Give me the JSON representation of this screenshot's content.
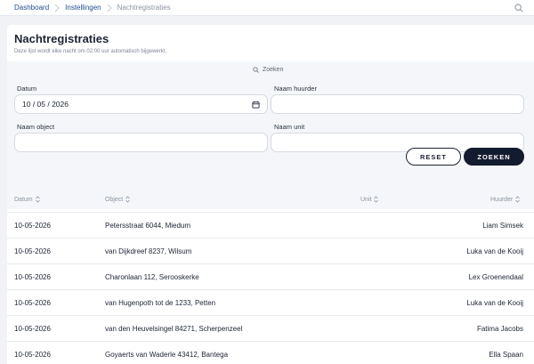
{
  "breadcrumb": [
    "Dashboard",
    "Instellingen",
    "Nachtregistraties"
  ],
  "page": {
    "title": "Nachtregistraties",
    "subtitle": "Deze lijst wordt elke nacht om 02:00 uur automatisch bijgewerkt."
  },
  "filters": {
    "toggle_label": "Zoeken",
    "datum_label": "Datum",
    "datum_value": "10 / 05 / 2026",
    "huurder_label": "Naam huurder",
    "huurder_value": "",
    "object_label": "Naam object",
    "object_value": "",
    "unit_label": "Naam unit",
    "unit_value": "",
    "reset_label": "RESET",
    "search_label": "ZOEKEN"
  },
  "table": {
    "columns": [
      "Datum",
      "Object",
      "Unit",
      "Huurder"
    ],
    "rows": [
      {
        "datum": "10-05-2026",
        "object": "Petersstraat 6044, Miedum",
        "unit": "",
        "huurder": "Liam Simsek"
      },
      {
        "datum": "10-05-2026",
        "object": "van Dijkdreef 8237, Wilsum",
        "unit": "",
        "huurder": "Luka van de Kooij"
      },
      {
        "datum": "10-05-2026",
        "object": "Charonlaan 112, Serooskerke",
        "unit": "",
        "huurder": "Lex Groenendaal"
      },
      {
        "datum": "10-05-2026",
        "object": "van Hugenpoth tot de 1233, Petten",
        "unit": "",
        "huurder": "Luka van de Kooij"
      },
      {
        "datum": "10-05-2026",
        "object": "van den Heuvelsingel 84271, Scherpenzeel",
        "unit": "",
        "huurder": "Fatima Jacobs"
      },
      {
        "datum": "10-05-2026",
        "object": "Goyaerts van Waderle 43412, Bantega",
        "unit": "",
        "huurder": "Ella Spaan"
      }
    ]
  },
  "colors": {
    "accent_dark": "#131b2e",
    "link_blue": "#1f4e8f",
    "page_bg": "#f1f2f5"
  },
  "icons": [
    "chevron-right-icon",
    "search-icon",
    "calendar-icon",
    "sort-icon"
  ]
}
